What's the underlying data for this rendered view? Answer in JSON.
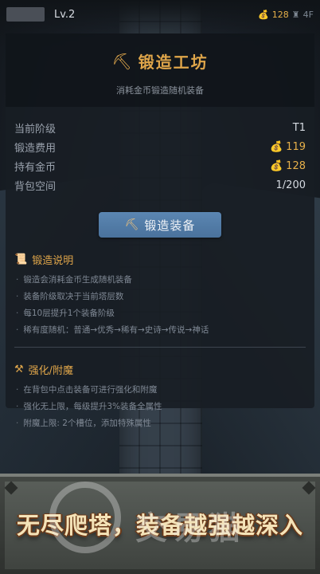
{
  "topbar": {
    "level": "Lv.2",
    "gold": "128",
    "floor": "4F"
  },
  "forge": {
    "title": "锻造工坊",
    "subtitle": "消耗金币锻造随机装备",
    "stats": [
      {
        "label": "当前阶级",
        "value": "T1"
      },
      {
        "label": "锻造费用",
        "value": "119"
      },
      {
        "label": "持有金币",
        "value": "128"
      },
      {
        "label": "背包空间",
        "value": "1/200"
      }
    ],
    "forge_button": "锻造装备",
    "guide": {
      "title": "锻造说明",
      "lines": [
        "锻造会消耗金币生成随机装备",
        "装备阶级取决于当前塔层数",
        "每10层提升1个装备阶级",
        "稀有度随机：普通→优秀→稀有→史诗→传说→神话"
      ]
    },
    "enhance": {
      "title": "强化/附魔",
      "lines": [
        "在背包中点击装备可进行强化和附魔",
        "强化无上限，每级提升3%装备全属性",
        "附魔上限: 2个槽位，添加特殊属性"
      ]
    }
  },
  "banner": {
    "slogan": "无尽爬塔，装备越强越深入",
    "watermark": "交易猫"
  },
  "colors": {
    "accent_gold": "#e0a64a",
    "button_blue": "#5b86b2",
    "panel_bg": "#181d24"
  },
  "icons": [
    "hammer-icon",
    "money-bag-icon",
    "scroll-icon",
    "tools-icon",
    "castle-icon"
  ]
}
